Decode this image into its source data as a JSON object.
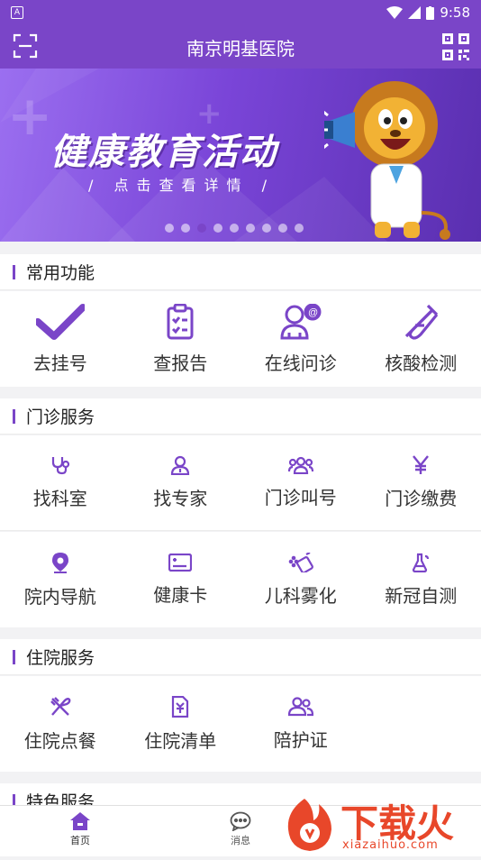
{
  "status_bar": {
    "time": "9:58",
    "left_icon": "A"
  },
  "app_bar": {
    "title": "南京明基医院"
  },
  "banner": {
    "title": "健康教育活动",
    "subtitle": "/ 点击查看详情 /"
  },
  "sections": {
    "common": {
      "title": "常用功能",
      "items": [
        {
          "label": "去挂号",
          "icon": "check-icon"
        },
        {
          "label": "查报告",
          "icon": "clipboard-icon"
        },
        {
          "label": "在线问诊",
          "icon": "doctor-chat-icon"
        },
        {
          "label": "核酸检测",
          "icon": "test-tube-icon"
        }
      ]
    },
    "outpatient": {
      "title": "门诊服务",
      "items": [
        {
          "label": "找科室",
          "icon": "stethoscope-icon"
        },
        {
          "label": "找专家",
          "icon": "doctor-icon"
        },
        {
          "label": "门诊叫号",
          "icon": "group-icon"
        },
        {
          "label": "门诊缴费",
          "icon": "yen-icon"
        },
        {
          "label": "院内导航",
          "icon": "location-pin-icon"
        },
        {
          "label": "健康卡",
          "icon": "card-icon"
        },
        {
          "label": "儿科雾化",
          "icon": "nebulizer-icon"
        },
        {
          "label": "新冠自测",
          "icon": "flask-icon"
        }
      ]
    },
    "inpatient": {
      "title": "住院服务",
      "items": [
        {
          "label": "住院点餐",
          "icon": "fork-knife-icon"
        },
        {
          "label": "住院清单",
          "icon": "yen-doc-icon"
        },
        {
          "label": "陪护证",
          "icon": "companion-icon"
        }
      ]
    },
    "special": {
      "title": "特色服务"
    }
  },
  "tab_bar": {
    "items": [
      {
        "label": "首页",
        "icon": "home-icon",
        "active": true
      },
      {
        "label": "消息",
        "icon": "message-icon",
        "active": false
      }
    ]
  },
  "watermark": {
    "text": "下载火",
    "url": "xiazaihuo.com"
  },
  "colors": {
    "accent": "#7a45c8",
    "watermark": "#e8472a"
  }
}
